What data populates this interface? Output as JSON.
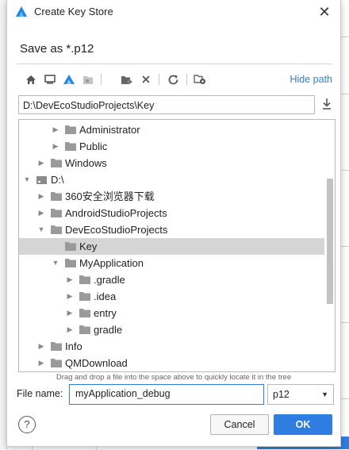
{
  "dialog": {
    "title": "Create Key Store",
    "subtitle": "Save as *.p12",
    "hide_path_label": "Hide path",
    "path_value": "D:\\DevEcoStudioProjects\\Key",
    "hint": "Drag and drop a file into the space above to quickly locate it in the tree",
    "file_name_label": "File name:",
    "file_name_value": "myApplication_debug",
    "extension_value": "p12",
    "cancel_label": "Cancel",
    "ok_label": "OK",
    "help_label": "?"
  },
  "toolbar": {
    "icons": [
      "home-icon",
      "desktop-icon",
      "project-icon",
      "module-icon",
      "new-folder-icon",
      "delete-icon",
      "refresh-icon",
      "show-hidden-icon"
    ]
  },
  "tree": {
    "rows": [
      {
        "label": "Administrator"
      },
      {
        "label": "Public"
      },
      {
        "label": "Windows"
      },
      {
        "label": "D:\\"
      },
      {
        "label": "360安全浏览器下载"
      },
      {
        "label": "AndroidStudioProjects"
      },
      {
        "label": "DevEcoStudioProjects"
      },
      {
        "label": "Key"
      },
      {
        "label": "MyApplication"
      },
      {
        "label": ".gradle"
      },
      {
        "label": ".idea"
      },
      {
        "label": "entry"
      },
      {
        "label": "gradle"
      },
      {
        "label": "Info"
      },
      {
        "label": "QMDownload"
      }
    ]
  },
  "colors": {
    "accent": "#2f7de1",
    "selection": "#d5d5d5",
    "folder": "#9a9a9a"
  }
}
